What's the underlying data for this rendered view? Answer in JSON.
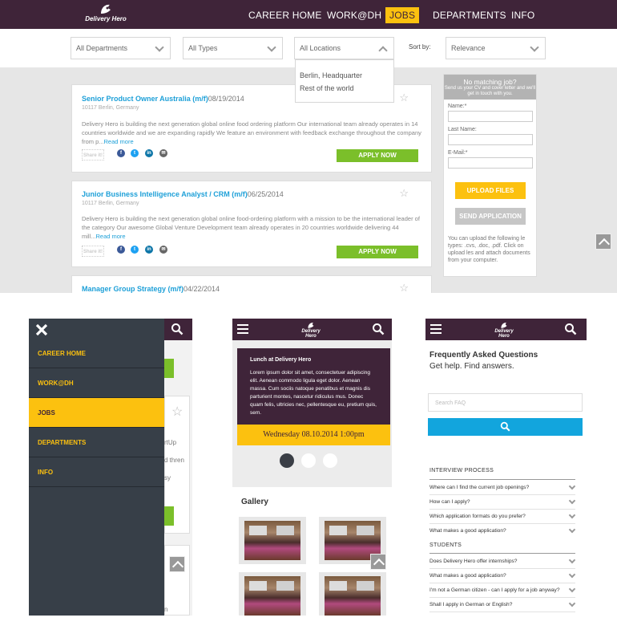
{
  "nav": {
    "logo_text": "Delivery Hero",
    "items": [
      {
        "label": "CAREER HOME",
        "active": false
      },
      {
        "label": "WORK@DH",
        "active": false
      },
      {
        "label": "JOBS",
        "active": true
      },
      {
        "label": "DEPARTMENTS",
        "active": false
      },
      {
        "label": "INFO",
        "active": false
      }
    ]
  },
  "filters": {
    "departments": "All Departments",
    "types": "All Types",
    "locations": "All Locations",
    "sort_label": "Sort by:",
    "sort_value": "Relevance",
    "location_options": [
      "Berlin, Headquarter",
      "Rest of the world"
    ]
  },
  "jobs": [
    {
      "title": "Senior Product Owner Australia (m/f)",
      "date": "08/19/2014",
      "location": "10117 Berlin, Germany",
      "description": "Delivery Hero is building the next generation global online food ordering platform Our international team already operates in 14 countries worldwide and we are expanding rapidly We feature an environment with feedback exchange throughout the company from p...",
      "read_more": "Read more",
      "apply": "APPLY NOW",
      "share": "Share it!"
    },
    {
      "title": "Junior Business Intelligence Analyst / CRM (m/f)",
      "date": "06/25/2014",
      "location": "10117 Berlin, Germany",
      "description": "Delivery Hero is building the next generation global online food-ordering platform with a mission to be the international leader of the category Our awesome Global Venture Development team already operates in 20 countries worldwide delivering 44 mill...",
      "read_more": "Read more",
      "apply": "APPLY NOW",
      "share": "Share it!"
    },
    {
      "title": "Manager Group Strategy (m/f)",
      "date": "04/22/2014"
    }
  ],
  "sidebar": {
    "heading": "No matching job?",
    "subheading": "Send us your CV and cover letter and we'll get in touch with you.",
    "name_label": "Name:*",
    "lastname_label": "Last Name:",
    "email_label": "E-Mail:*",
    "upload": "UPLOAD FILES",
    "send": "SEND APPLICATION",
    "note": "You can upload the following le types: .cvs, .doc, .pdf. Click on upload les and attach documents from your computer."
  },
  "mobile_menu": {
    "items": [
      {
        "label": "CAREER HOME",
        "active": false
      },
      {
        "label": "WORK@DH",
        "active": false
      },
      {
        "label": "JOBS",
        "active": true
      },
      {
        "label": "DEPARTMENTS",
        "active": false
      },
      {
        "label": "INFO",
        "active": false
      }
    ],
    "peek_texts": [
      "rtUp",
      "d thren",
      "sy",
      "n"
    ]
  },
  "mobile_home": {
    "logo_text": "Delivery Hero",
    "card_title": "Lunch at Delivery Hero",
    "card_text": "Lorem ipsum dolor sit amet, consectetuer adipiscing elit. Aenean commodo ligula eget dolor. Aenean massa. Cum sociis natoque penatibus et magnis dis parturient montes, nascetur ridiculus mus. Donec quam felis, ultricies nec, pellentesque eu, pretium quis, sem.",
    "date_bar": "Wednesday 08.10.2014 1:00pm",
    "gallery_title": "Gallery"
  },
  "mobile_faq": {
    "logo_text": "Delivery Hero",
    "title": "Frequently Asked Questions",
    "subtitle": "Get help. Find answers.",
    "search_placeholder": "Search FAQ",
    "sections": [
      {
        "name": "INTERVIEW PROCESS",
        "questions": [
          "Where can I find the current job openings?",
          "How can I apply?",
          "Which application formats do you prefer?",
          "What makes a good application?"
        ]
      },
      {
        "name": "STUDENTS",
        "questions": [
          "Does Delivery Hero offer internships?",
          "What makes a good application?",
          "I'm not a German citizen - can I apply for a job anyway?",
          "Shall I apply in German or English?"
        ]
      }
    ]
  },
  "colors": {
    "brand": "#3f2439",
    "accent": "#fcc10f",
    "link": "#1ea0d8",
    "apply": "#7bbf2a",
    "faq_button": "#12a5dd"
  }
}
